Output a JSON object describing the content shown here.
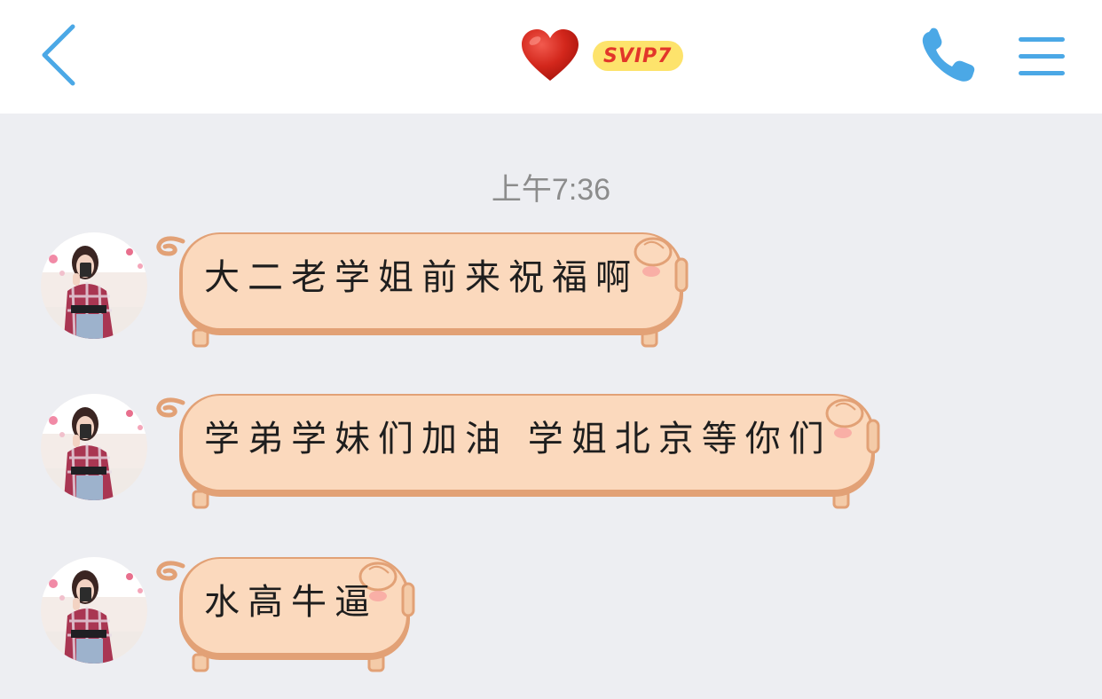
{
  "header": {
    "back_icon": "chevron-left-icon",
    "title_icon": "heart-icon",
    "badge_text": "SVIP7",
    "call_icon": "phone-icon",
    "menu_icon": "hamburger-menu-icon",
    "accent_color": "#4ba8e6"
  },
  "chat": {
    "timestamp": "上午7:36",
    "messages": [
      {
        "text": "大二老学姐前来祝福啊"
      },
      {
        "text": "学弟学妹们加油 学姐北京等你们"
      },
      {
        "text": "水高牛逼"
      }
    ]
  }
}
